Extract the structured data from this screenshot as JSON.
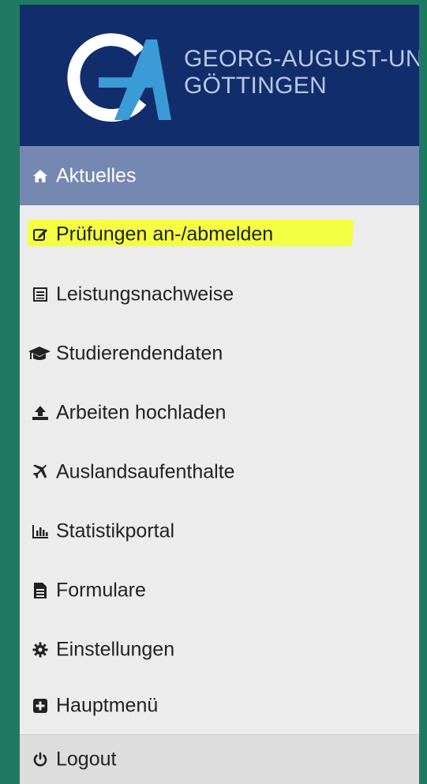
{
  "header": {
    "logo_text": "GA",
    "university_line1": "GEORG-AUGUST-UNIVERSITÄT",
    "university_line2": "GÖTTINGEN"
  },
  "menu": {
    "active": {
      "label": "Aktuelles",
      "icon": "home-icon"
    },
    "items": [
      {
        "label": "Prüfungen an-/abmelden",
        "icon": "edit-icon",
        "highlighted": true
      },
      {
        "label": "Leistungsnachweise",
        "icon": "list-icon"
      },
      {
        "label": "Studierendendaten",
        "icon": "graduation-cap-icon"
      },
      {
        "label": "Arbeiten hochladen",
        "icon": "upload-icon"
      },
      {
        "label": "Auslandsaufenthalte",
        "icon": "plane-icon"
      },
      {
        "label": "Statistikportal",
        "icon": "bar-chart-icon"
      },
      {
        "label": "Formulare",
        "icon": "document-icon"
      },
      {
        "label": "Einstellungen",
        "icon": "gear-icon"
      },
      {
        "label": "Hauptmenü",
        "icon": "plus-square-icon"
      }
    ],
    "logout": {
      "label": "Logout",
      "icon": "power-icon"
    }
  },
  "colors": {
    "background": "#1f7a62",
    "header": "#112d6b",
    "active_row": "#7588b2",
    "highlight": "#f4ff3a"
  }
}
